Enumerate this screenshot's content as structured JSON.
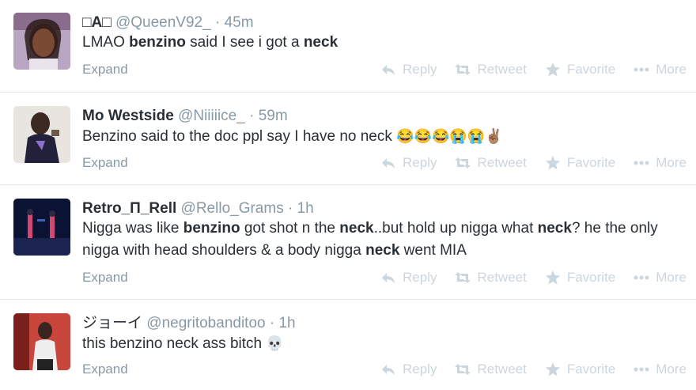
{
  "actions": {
    "reply": "Reply",
    "retweet": "Retweet",
    "favorite": "Favorite",
    "more": "More"
  },
  "tweets": [
    {
      "name": "□A□",
      "handle": "@QueenV92_",
      "sep": "·",
      "time": "45m",
      "segments": [
        {
          "t": "LMAO ",
          "b": false
        },
        {
          "t": "benzino",
          "b": true
        },
        {
          "t": " said I see i got a ",
          "b": false
        },
        {
          "t": "neck",
          "b": true
        }
      ],
      "expand": "Expand"
    },
    {
      "name": "Mo Westside",
      "handle": "@Niiiiice_",
      "sep": "·",
      "time": "59m",
      "segments": [
        {
          "t": "Benzino said to the doc ppl say I have no neck ",
          "b": false
        }
      ],
      "emoji": "😂😂😂😭😭✌🏽",
      "expand": "Expand"
    },
    {
      "name": "Retro_П_Rell",
      "handle": "@Rello_Grams",
      "sep": "·",
      "time": "1h",
      "segments": [
        {
          "t": "Nigga was like ",
          "b": false
        },
        {
          "t": "benzino",
          "b": true
        },
        {
          "t": " got shot n the ",
          "b": false
        },
        {
          "t": "neck",
          "b": true
        },
        {
          "t": "..but hold up nigga what ",
          "b": false
        },
        {
          "t": "neck",
          "b": true
        },
        {
          "t": "? he the only nigga with head shoulders & a body nigga ",
          "b": false
        },
        {
          "t": "neck",
          "b": true
        },
        {
          "t": " went MIA",
          "b": false
        }
      ],
      "expand": "Expand"
    },
    {
      "name": "ジョーイ",
      "handle": "@negritobanditoo",
      "sep": "·",
      "time": "1h",
      "segments": [
        {
          "t": "this benzino neck ass bitch ",
          "b": false
        }
      ],
      "emoji": "💀",
      "expand": "Expand"
    }
  ]
}
